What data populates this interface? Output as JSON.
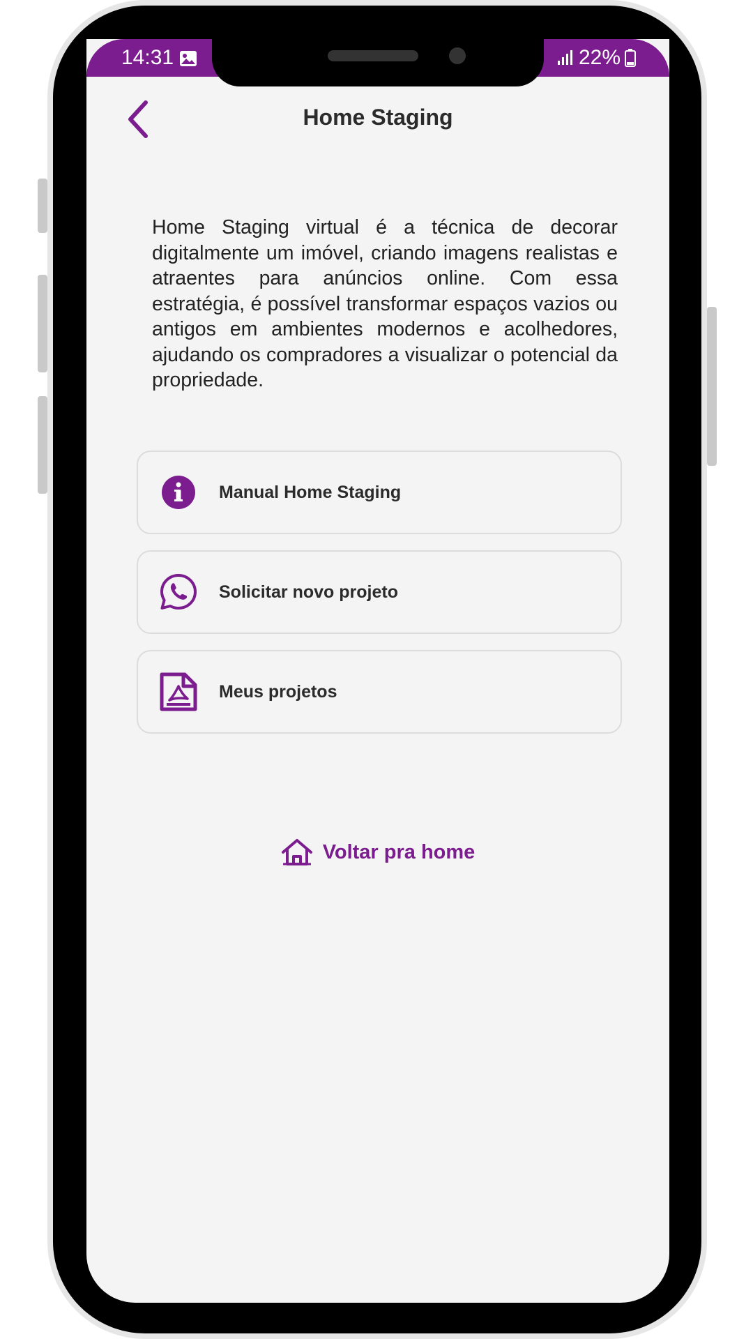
{
  "status_bar": {
    "time": "14:31",
    "battery": "22%",
    "gallery_icon": "image-icon",
    "signal_icon": "signal-icon",
    "battery_icon": "battery-icon"
  },
  "header": {
    "title": "Home Staging",
    "back_icon": "chevron-left-icon"
  },
  "description": "Home Staging virtual é a técnica de decorar digitalmente um imóvel, criando imagens realistas e atraentes para anúncios online. Com essa estratégia, é possível transformar espaços vazios ou antigos em ambientes modernos e acolhedores, ajudando os compradores a visualizar o potencial da propriedade.",
  "menu": {
    "items": [
      {
        "label": "Manual Home Staging",
        "icon": "info-icon"
      },
      {
        "label": "Solicitar novo projeto",
        "icon": "whatsapp-icon"
      },
      {
        "label": "Meus projetos",
        "icon": "pdf-file-icon"
      }
    ]
  },
  "footer": {
    "home_link_label": "Voltar pra home",
    "home_icon": "home-icon"
  },
  "colors": {
    "accent": "#7b1d8e",
    "background": "#f4f4f4",
    "text": "#2b2b2b"
  }
}
